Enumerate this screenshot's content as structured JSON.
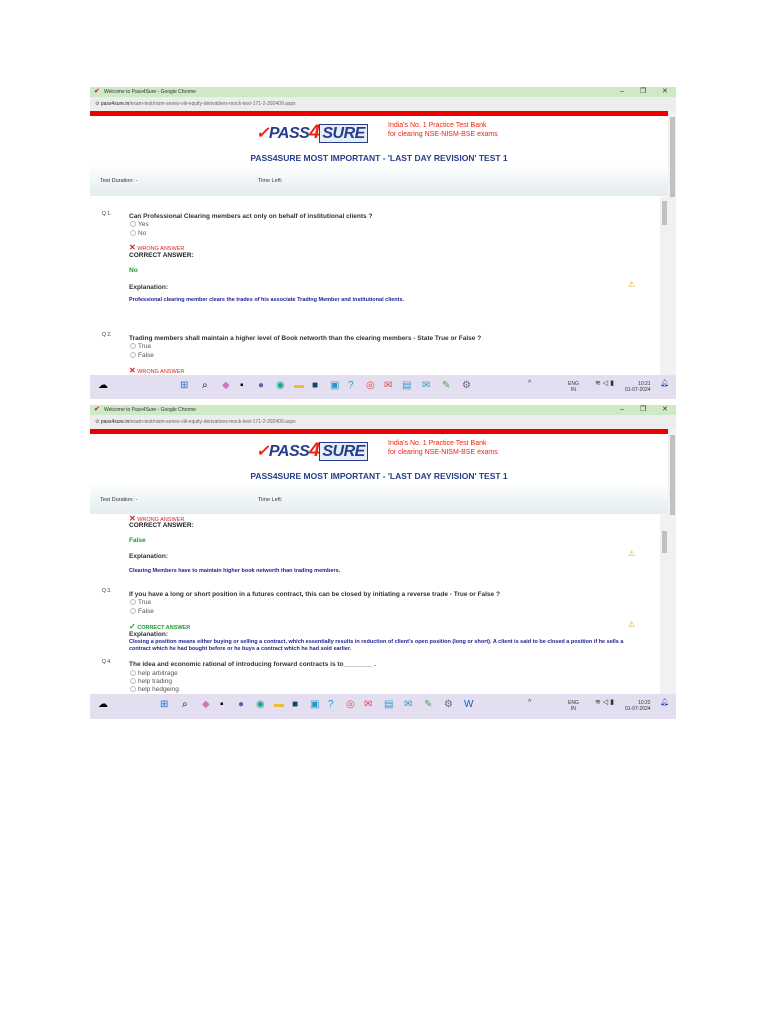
{
  "window": {
    "title": "Welcome to Pass4Sure - Google Chrome",
    "url_host": "pass4sure.in",
    "url_path": "/exam-test/nism-series-viii-equity-derivatives-mock-test-171-2-392409.aspx",
    "min": "–",
    "restore": "❐",
    "close": "✕"
  },
  "header": {
    "logo_check": "✓",
    "logo_pass": "PASS",
    "logo_four": "4",
    "logo_sure": "SURE",
    "tagline1": "India's No. 1 Practice Test Bank",
    "tagline2": "for clearing NSE-NISM-BSE exams",
    "title": "PASS4SURE MOST IMPORTANT - 'LAST DAY REVISION' TEST 1",
    "duration": "Test Duration: -",
    "time_left": "Time Left:"
  },
  "labels": {
    "wrong": "WRONG ANSWER",
    "correct_answer": "CORRECT ANSWER:",
    "correct": "CORRECT ANSWER",
    "explanation": "Explanation:",
    "x": "✕",
    "check": "✓",
    "warn": "⚠"
  },
  "q1": {
    "num": "Q 1.",
    "text": "Can Professional Clearing members act only on behalf of institutional clients ?",
    "options": [
      "Yes",
      "No"
    ],
    "answer": "No",
    "explanation": "Professional clearing member clears the trades of his associate Trading Member and institutional clients."
  },
  "q2": {
    "num": "Q 2.",
    "text": "Trading members shall maintain a higher level of Book networth than the clearing members - State True or False ?",
    "options": [
      "True",
      "False"
    ],
    "answer": "False",
    "explanation": "Clearing Members have to maintain higher book networth than trading members."
  },
  "q3": {
    "num": "Q 3.",
    "text": "If you have a long or short position in a futures contract, this can be closed by initiating a reverse trade - True or False ?",
    "options": [
      "True",
      "False"
    ],
    "explanation": "Closing a position means either buying or selling a contract, which essentially results in reduction of client's open position (long or short). A client is said to be closed a position if he sells a contract which he had bought before or he buys a contract which he had sold earlier."
  },
  "q4": {
    "num": "Q 4.",
    "text": "The idea and economic rational of introducing forward contracts is to________ .",
    "options": [
      "help arbitrage",
      "help trading",
      "help hedgeing"
    ]
  },
  "taskbar": {
    "lang1": "ENG",
    "lang2": "IN",
    "time1": "10:21",
    "time2": "10:22",
    "date": "01-07-2024"
  }
}
